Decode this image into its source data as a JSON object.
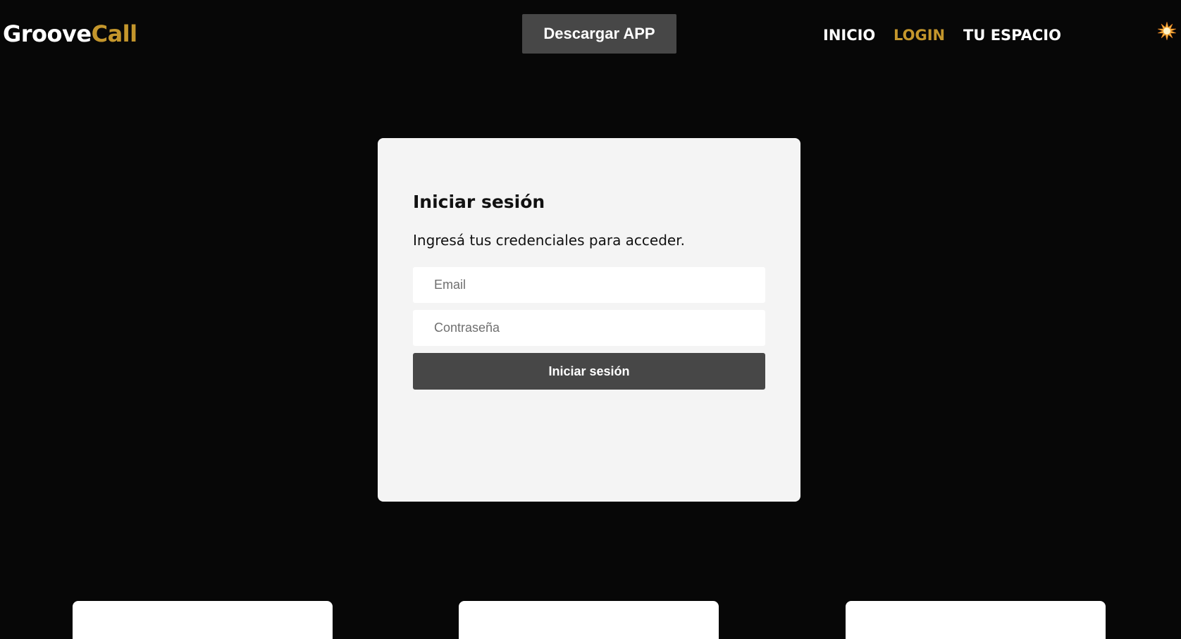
{
  "header": {
    "logo": {
      "part1": "Groove",
      "part2": "Call"
    },
    "download_button": "Descargar APP",
    "nav": [
      {
        "label": "INICIO",
        "active": false
      },
      {
        "label": "LOGIN",
        "active": true
      },
      {
        "label": "TU ESPACIO",
        "active": false
      }
    ],
    "theme_toggle_icon": "sun-icon"
  },
  "login": {
    "title": "Iniciar sesión",
    "subtitle": "Ingresá tus credenciales para acceder.",
    "email": {
      "value": "",
      "placeholder": "Email"
    },
    "password": {
      "value": "",
      "placeholder": "Contraseña"
    },
    "submit_label": "Iniciar sesión"
  },
  "colors": {
    "background": "#070707",
    "accent": "#c4962c",
    "button": "#474747",
    "card": "#f4f4f4"
  }
}
